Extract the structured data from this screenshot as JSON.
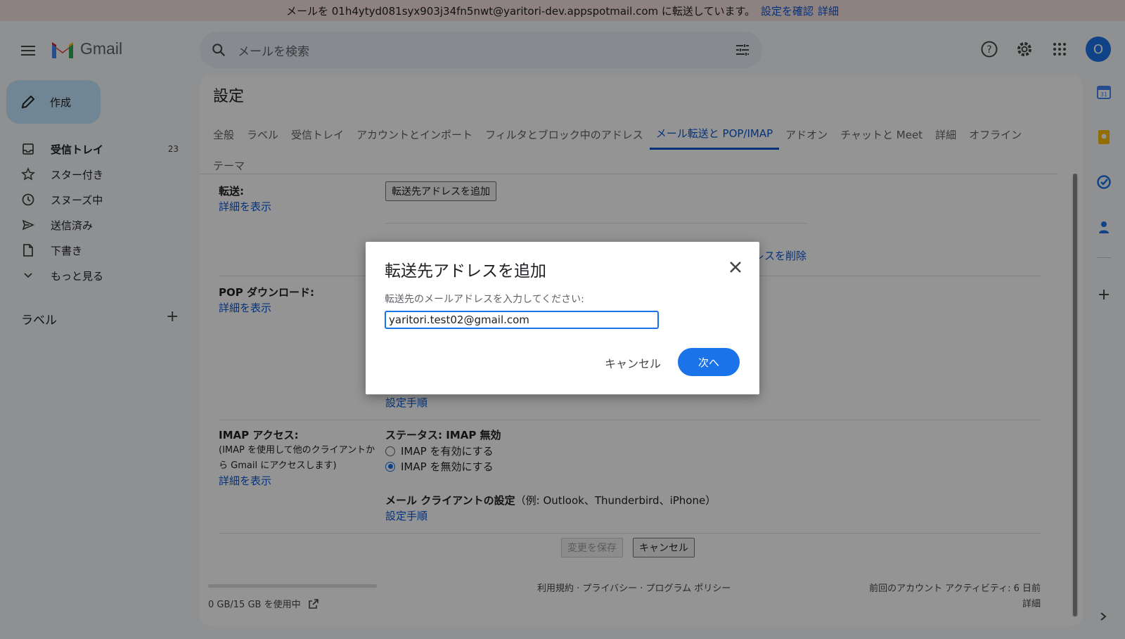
{
  "banner": {
    "message": "メールを 01h4ytyd081syx903j34fn5nwt@yaritori-dev.appspotmail.com に転送しています。",
    "confirm_link": "設定を確認",
    "details_link": "詳細"
  },
  "header": {
    "app_name": "Gmail",
    "search_placeholder": "メールを検索",
    "avatar_letter": "O"
  },
  "sidebar": {
    "compose_label": "作成",
    "items": [
      {
        "label": "受信トレイ",
        "count": "23",
        "icon": "inbox-icon",
        "bold": true
      },
      {
        "label": "スター付き",
        "count": "",
        "icon": "star-icon"
      },
      {
        "label": "スヌーズ中",
        "count": "",
        "icon": "clock-icon"
      },
      {
        "label": "送信済み",
        "count": "",
        "icon": "send-icon"
      },
      {
        "label": "下書き",
        "count": "",
        "icon": "draft-icon"
      },
      {
        "label": "もっと見る",
        "count": "",
        "icon": "chevron-down-icon"
      }
    ],
    "labels_heading": "ラベル"
  },
  "settings": {
    "title": "設定",
    "tabs": [
      "全般",
      "ラベル",
      "受信トレイ",
      "アカウントとインポート",
      "フィルタとブロック中のアドレス",
      "メール転送と POP/IMAP",
      "アドオン",
      "チャットと Meet",
      "詳細",
      "オフライン",
      "テーマ"
    ],
    "active_tab": "メール転送と POP/IMAP",
    "forwarding": {
      "label": "転送:",
      "details_link": "詳細を表示",
      "add_button": "転送先アドレスを追加",
      "delete_link_partial": "ドレスを削除"
    },
    "pop": {
      "label": "POP ダウンロード:",
      "details_link": "詳細を表示",
      "setup_link": "設定手順"
    },
    "imap": {
      "label": "IMAP アクセス:",
      "note": "(IMAP を使用して他のクライアントから Gmail にアクセスします)",
      "details_link": "詳細を表示",
      "status": "ステータス: IMAP 無効",
      "enable_option": "IMAP を有効にする",
      "disable_option": "IMAP を無効にする",
      "client_heading": "メール クライアントの設定",
      "client_examples": "（例: Outlook、Thunderbird、iPhone）",
      "setup_link": "設定手順"
    },
    "save_button": "変更を保存",
    "cancel_button": "キャンセル",
    "footer": {
      "storage": "0 GB/15 GB を使用中",
      "policies": "利用規約 · プライバシー · プログラム ポリシー",
      "last_activity": "前回のアカウント アクティビティ: 6 日前",
      "details": "詳細"
    }
  },
  "dialog": {
    "title": "転送先アドレスを追加",
    "prompt": "転送先のメールアドレスを入力してください:",
    "input_value": "yaritori.test02@gmail.com",
    "cancel_label": "キャンセル",
    "next_label": "次へ"
  },
  "colors": {
    "accent": "#1a73e8",
    "link": "#0b57d0",
    "compose_bg": "#c2e7ff",
    "banner_bg": "#f3dede"
  }
}
